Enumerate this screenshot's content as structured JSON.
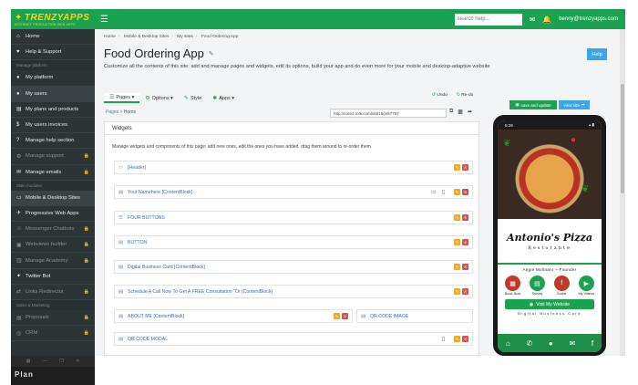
{
  "header": {
    "logo_text": "TRENZYAPPS",
    "logo_tagline": "INTERNET PRODUCTION WEB APPS",
    "search_placeholder": "search help...",
    "user_email": "benny@trenzyapps.com"
  },
  "sidebar": {
    "items": [
      {
        "icon": "⌂",
        "label": "Home"
      },
      {
        "icon": "♥",
        "label": "Help & Support"
      }
    ],
    "section1": "Manage platform",
    "platform_items": [
      {
        "icon": "👤",
        "label": "My platform"
      },
      {
        "icon": "👥",
        "label": "My users"
      },
      {
        "icon": "▤",
        "label": "My plans and products"
      },
      {
        "icon": "$",
        "label": "My users invoices"
      },
      {
        "icon": "?",
        "label": "Manage help section"
      },
      {
        "icon": "⚙",
        "label": "Manage support"
      },
      {
        "icon": "✉",
        "label": "Manage emails"
      }
    ],
    "section2": "Main modules",
    "module_items": [
      {
        "icon": "▭",
        "label": "Mobile & Desktop Sites"
      },
      {
        "icon": "✈",
        "label": "Progressive Web Apps"
      },
      {
        "icon": "☺",
        "label": "Messenger Chatbots"
      },
      {
        "icon": "▣",
        "label": "Webviews builder"
      },
      {
        "icon": "▥",
        "label": "Manage Academy"
      },
      {
        "icon": "✦",
        "label": "Twitter Bot"
      },
      {
        "icon": "⇄",
        "label": "Links Redirector"
      }
    ],
    "section3": "Sales & Marketing",
    "sales_items": [
      {
        "icon": "▤",
        "label": "Proposals"
      },
      {
        "icon": "◎",
        "label": "CRM"
      }
    ]
  },
  "dock": {
    "text": "Plan"
  },
  "main": {
    "breadcrumb": [
      "Home",
      "Mobile & Desktop Sites",
      "My sites",
      "Food Ordering App"
    ],
    "title": "Food Ordering App",
    "subtitle": "Customize all the contents of this site: add and manage pages and widgets, edit its options, build your app and do even more for your mobile and desktop-adaptive website",
    "help_label": "Help",
    "tabs": [
      {
        "icon": "☰",
        "label": "Pages ▾"
      },
      {
        "icon": "⚙",
        "label": "Options ▾"
      },
      {
        "icon": "✎",
        "label": "Style"
      },
      {
        "icon": "✱",
        "label": "Apps ▾"
      }
    ],
    "undo_label": "Undo",
    "redo_label": "Re-do",
    "pages_label": "Pages",
    "pages_current": "Home",
    "url": "http://core3.mtk.com/s6015/p/67757",
    "save_label": "save and update",
    "view_label": "view site",
    "widgets_title": "Widgets",
    "widgets_desc": "Manage widgets and components of this page: add new ones, edit the ones you have added, drag them around to re-order them",
    "widgets": [
      {
        "icon": "▭",
        "label": "[Header]"
      },
      {
        "icon": "▤",
        "label": "Your Namehere [ContentBlock]"
      },
      {
        "icon": "☰",
        "label": "FOUR BUTTONS"
      },
      {
        "icon": "▤",
        "label": "BUTTON"
      },
      {
        "icon": "▤",
        "label": "Digital Business Card [ContentBlock]"
      },
      {
        "icon": "▤",
        "label": "Schedule A Call Now To Get A FREE Consultation \"Or [ContentBlock]"
      },
      {
        "icon": "▤",
        "label": "ABOUT ME [ContentBlock]"
      },
      {
        "icon": "▤",
        "label": "QR CODE IMAGE"
      },
      {
        "icon": "▤",
        "label": "QR CODE MODAL"
      }
    ]
  },
  "phone": {
    "time": "5:29",
    "brand_name": "Antonio's Pizza",
    "brand_sub": "Restorante",
    "founder": "Angie Molinaro ~ Founder",
    "buttons": [
      {
        "icon": "▦",
        "label": "Book Now",
        "color": "#c0392b"
      },
      {
        "icon": "▤",
        "label": "Survey",
        "color": "#1aa250"
      },
      {
        "icon": "f",
        "label": "Social",
        "color": "#c0392b"
      },
      {
        "icon": "▶",
        "label": "My Videos",
        "color": "#1aa250"
      }
    ],
    "visit_label": "Visit My Website",
    "dbc_label": "Digital Business Card"
  }
}
